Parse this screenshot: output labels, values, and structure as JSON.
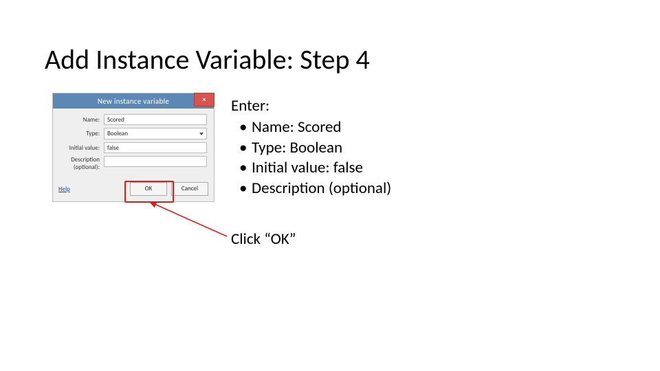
{
  "slide": {
    "title": "Add Instance Variable: Step 4"
  },
  "dialog": {
    "title": "New instance variable",
    "close_label": "×",
    "fields": {
      "name_label": "Name:",
      "name_value": "Scored",
      "type_label": "Type:",
      "type_value": "Boolean",
      "initval_label": "Initial value:",
      "initval_value": "false",
      "desc_label_line1": "Description",
      "desc_label_line2": "(optional):"
    },
    "footer": {
      "help": "Help",
      "ok": "OK",
      "cancel": "Cancel"
    }
  },
  "instructions": {
    "heading": "Enter:",
    "items": [
      "Name: Scored",
      "Type: Boolean",
      "Initial value: false",
      "Description (optional)"
    ],
    "click_ok": "Click “OK”"
  },
  "annotation": {
    "highlight_color": "#d9201c"
  }
}
